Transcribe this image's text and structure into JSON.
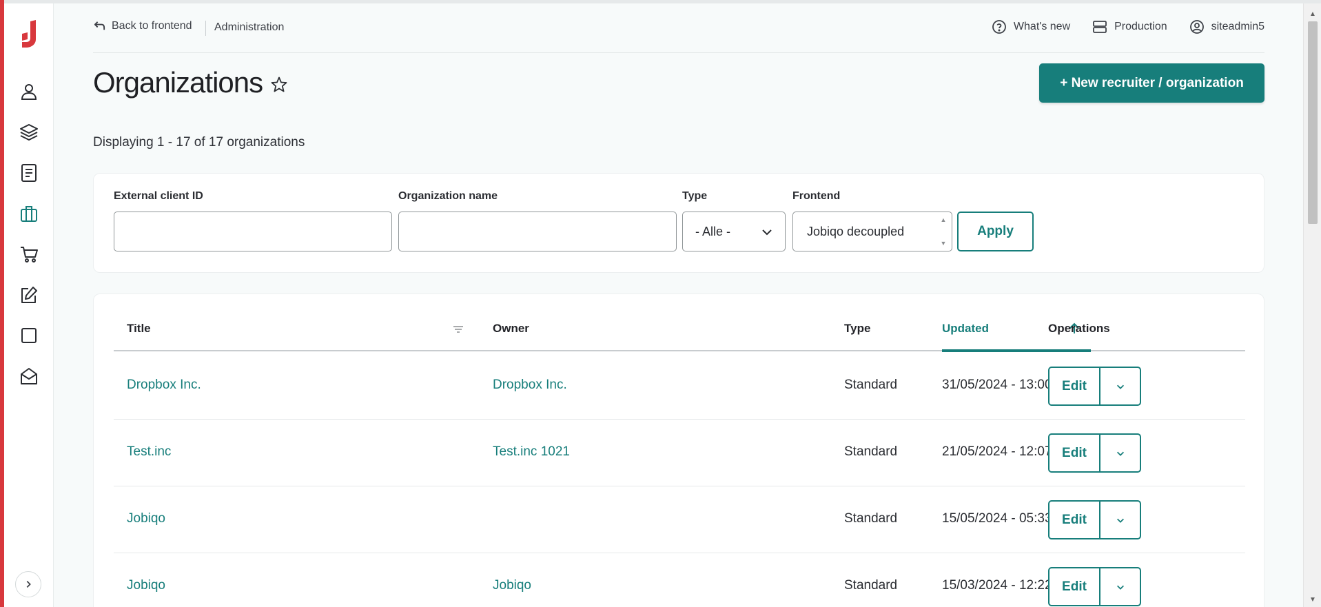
{
  "colors": {
    "accent": "#177e7b",
    "brand_red": "#d8383d"
  },
  "sidebar": {
    "logo": "brand-logo",
    "items": [
      {
        "name": "sidebar-item-users",
        "icon": "user-icon"
      },
      {
        "name": "sidebar-item-structure",
        "icon": "layers-icon"
      },
      {
        "name": "sidebar-item-content",
        "icon": "document-icon"
      },
      {
        "name": "sidebar-item-organizations",
        "icon": "briefcase-icon",
        "active": true
      },
      {
        "name": "sidebar-item-commerce",
        "icon": "cart-icon"
      },
      {
        "name": "sidebar-item-edit",
        "icon": "edit-icon"
      },
      {
        "name": "sidebar-item-blocks",
        "icon": "square-icon"
      },
      {
        "name": "sidebar-item-messages",
        "icon": "mail-open-icon"
      }
    ]
  },
  "topbar": {
    "back_label": "Back to frontend",
    "admin_label": "Administration",
    "whats_new": "What's new",
    "environment": "Production",
    "user": "siteadmin5"
  },
  "page": {
    "title": "Organizations",
    "new_button": "+ New recruiter / organization",
    "display_count": "Displaying 1 - 17 of 17 organizations"
  },
  "filters": {
    "external_id_label": "External client ID",
    "external_id_value": "",
    "org_name_label": "Organization name",
    "org_name_value": "",
    "type_label": "Type",
    "type_value": "- Alle -",
    "frontend_label": "Frontend",
    "frontend_value": "Jobiqo decoupled",
    "apply_label": "Apply"
  },
  "table": {
    "headers": {
      "title": "Title",
      "owner": "Owner",
      "type": "Type",
      "updated": "Updated",
      "operations": "Operations"
    },
    "edit_label": "Edit",
    "rows": [
      {
        "title": "Dropbox Inc.",
        "owner": "Dropbox Inc.",
        "type": "Standard",
        "updated": "31/05/2024 - 13:00"
      },
      {
        "title": "Test.inc",
        "owner": "Test.inc 1021",
        "type": "Standard",
        "updated": "21/05/2024 - 12:07"
      },
      {
        "title": "Jobiqo",
        "owner": "",
        "type": "Standard",
        "updated": "15/05/2024 - 05:33"
      },
      {
        "title": "Jobiqo",
        "owner": "Jobiqo",
        "type": "Standard",
        "updated": "15/03/2024 - 12:22"
      }
    ]
  }
}
